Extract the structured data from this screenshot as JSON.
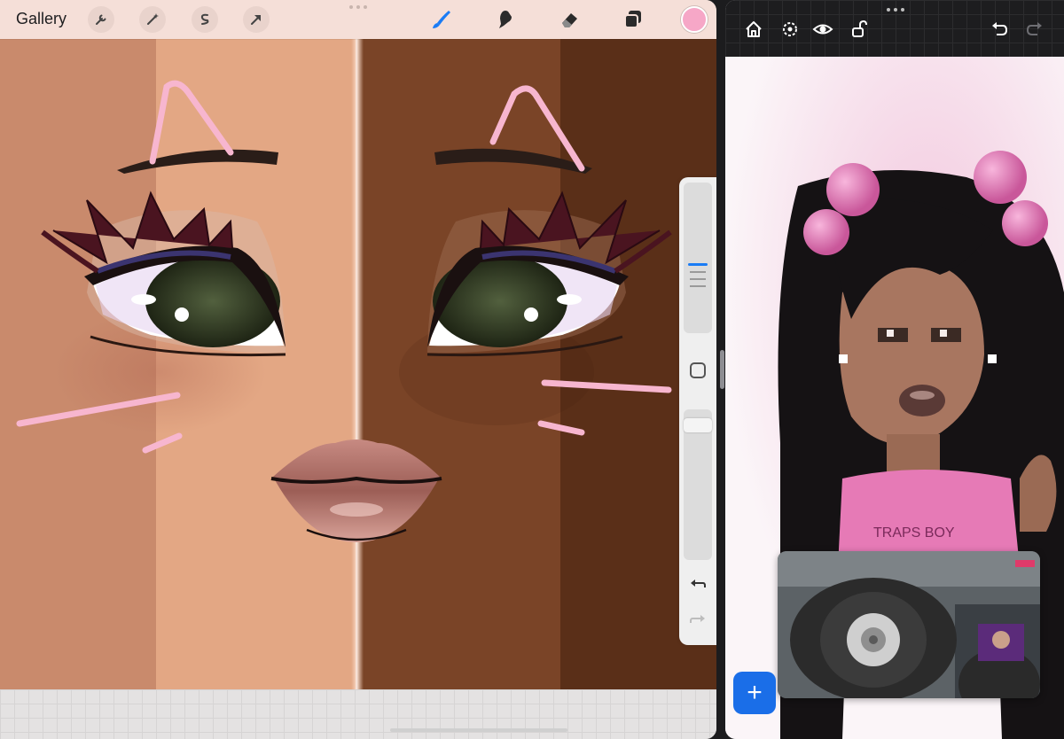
{
  "left_app": {
    "gallery_label": "Gallery",
    "toolbar_left_icons": [
      "wrench-icon",
      "magic-wand-icon",
      "selection-icon",
      "transform-arrow-icon"
    ],
    "toolbar_right_icons": [
      "brush-icon",
      "smudge-icon",
      "eraser-icon",
      "layers-icon"
    ],
    "active_tool": "brush",
    "current_color": "#f6a7c7",
    "canvas": {
      "skin_swatches": [
        "#c98a6c",
        "#e3a784",
        "#7a4427",
        "#5a2f18"
      ],
      "guide_stroke_color": "#f7b6cf"
    },
    "sidebar": {
      "brush_size_level": 0.55,
      "opacity_level": 0.8,
      "modify_button_icon": "square-icon",
      "undo_icon": "undo-icon",
      "redo_icon": "redo-icon"
    }
  },
  "right_app": {
    "toolbar_icons": [
      "home-icon",
      "settings-icon",
      "eye-icon",
      "unlock-icon",
      "undo-icon",
      "redo-icon"
    ],
    "add_button_label": "+",
    "pip_video": {
      "description_icon": "video-thumbnail"
    }
  }
}
